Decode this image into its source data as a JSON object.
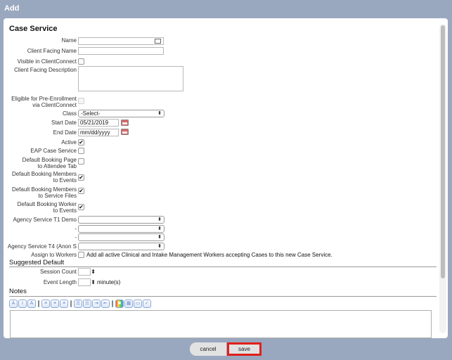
{
  "title": "Add",
  "heading": "Case Service",
  "fields": {
    "name": "Name",
    "client_facing_name": "Client Facing Name",
    "visible": "Visible in ClientConnect",
    "client_facing_desc": "Client Facing Description",
    "eligible_1": "Eligible for Pre-Enrollment",
    "eligible_2": "via ClientConnect",
    "class": "Class",
    "class_value": "-Select-",
    "start_date": "Start Date",
    "start_value": "05/21/2019",
    "end_date": "End Date",
    "end_placeholder": "mm/dd/yyyy",
    "active": "Active",
    "eap": "EAP Case Service",
    "dbp_1": "Default Booking Page",
    "dbp_2": "to Attendee Tab",
    "dbm_1": "Default Booking Members",
    "dbm_2": "to Events",
    "dbms_1": "Default Booking Members",
    "dbms_2": "to Service Files",
    "dbw_1": "Default Booking Worker",
    "dbw_2": "to Events",
    "ast1": "Agency Service T1 Demo",
    "dash1": "-",
    "dash2": "-",
    "ast4": "Agency Service T4 (Anon S",
    "assign": "Assign to Workers",
    "assign_text": "Add all active Clinical and Intake Management Workers accepting Cases to this new Case Service.",
    "check": "✔"
  },
  "suggested": {
    "title": "Suggested Default",
    "session": "Session Count",
    "event": "Event Length",
    "minutes": "minute(s)"
  },
  "notes": {
    "title": "Notes"
  },
  "toolbar": {
    "icons": [
      "A",
      "I",
      "A",
      "≡",
      "≡",
      "≡",
      "☰",
      "☰",
      "⇥",
      "⇤",
      "■",
      "▦",
      "▭",
      "✓"
    ]
  },
  "buttons": {
    "cancel": "cancel",
    "save": "save"
  }
}
